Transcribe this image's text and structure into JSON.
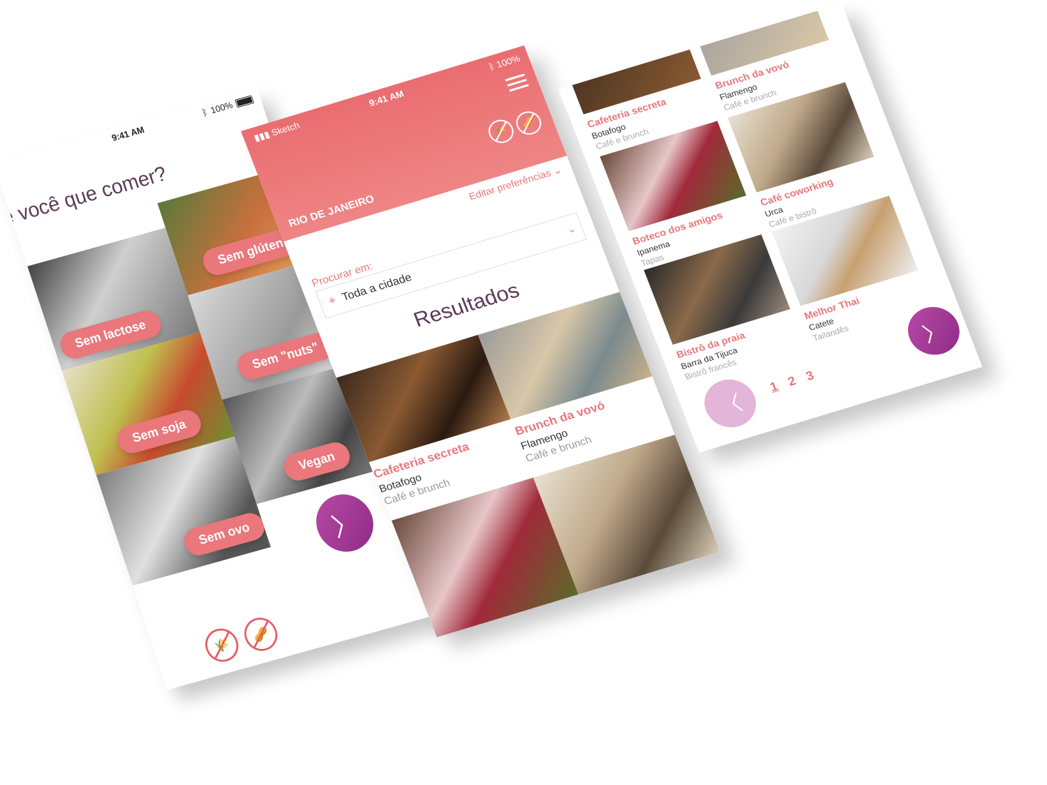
{
  "screen1": {
    "status": {
      "time": "9:41 AM",
      "battery": "100%"
    },
    "question": "e você que comer?",
    "options": [
      {
        "label": "Sem glúten"
      },
      {
        "label": "Sem lactose"
      },
      {
        "label": "Sem \"nuts\""
      },
      {
        "label": "Sem soja"
      },
      {
        "label": "Vegan"
      },
      {
        "label": "Sem ovo"
      }
    ],
    "next_label": "〉",
    "selected_icons": [
      "no-gluten-icon",
      "no-nuts-icon"
    ]
  },
  "screen2": {
    "status": {
      "carrier": "Sketch",
      "time": "9:41 AM",
      "battery": "100%"
    },
    "city": "RIO DE JANEIRO",
    "edit_prefs": "Editar preferências",
    "search_label": "Procurar em:",
    "search_value": "Toda a cidade",
    "results_title": "Resultados",
    "results": [
      {
        "name": "Cafeteria secreta",
        "hood": "Botafogo",
        "cat": "Café e brunch"
      },
      {
        "name": "Brunch da vovó",
        "hood": "Flamengo",
        "cat": "Café e brunch"
      }
    ]
  },
  "screen3": {
    "results": [
      {
        "name": "Cafeteria secreta",
        "hood": "Botafogo",
        "cat": "Café e brunch"
      },
      {
        "name": "Brunch da vovó",
        "hood": "Flamengo",
        "cat": "Café e brunch"
      },
      {
        "name": "Boteco dos amigos",
        "hood": "Ipanema",
        "cat": "Tapas"
      },
      {
        "name": "Café coworking",
        "hood": "Urca",
        "cat": "Café e bistrô"
      },
      {
        "name": "Bistrô da praia",
        "hood": "Barra da Tijuca",
        "cat": "Bistrô francês"
      },
      {
        "name": "Melhor Thai",
        "hood": "Catete",
        "cat": "Tailandês"
      }
    ],
    "pages": [
      "1",
      "2",
      "3"
    ],
    "prev_label": "〈",
    "next_label": "〉"
  },
  "colors": {
    "accent": "#e9777b",
    "header": "#ec7477",
    "purple": "#9c3594",
    "title": "#5a3b57"
  }
}
